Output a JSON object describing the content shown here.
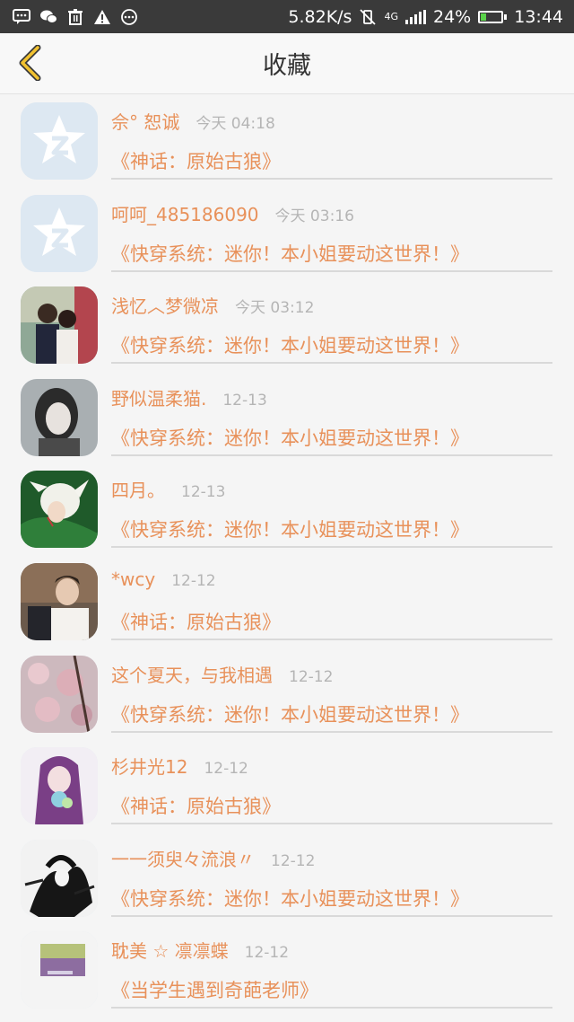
{
  "status_bar": {
    "net_speed": "5.82K/s",
    "network": "4G",
    "battery": "24%",
    "battery_level": 0.24,
    "time": "13:44"
  },
  "header": {
    "title": "收藏",
    "back_icon": "chevron-left-icon"
  },
  "items": [
    {
      "user": "佘° 恕诚",
      "time": "今天 04:18",
      "book": "《神话：原始古狼》",
      "avatar": "qq-default"
    },
    {
      "user": "呵呵_485186090",
      "time": "今天 03:16",
      "book": "《快穿系统：迷你！本小姐要动这世界！》",
      "avatar": "qq-default"
    },
    {
      "user": "浅忆︿梦微凉",
      "time": "今天 03:12",
      "book": "《快穿系统：迷你！本小姐要动这世界！》",
      "avatar": "couple-photo"
    },
    {
      "user": "野似温柔猫.",
      "time": "12-13",
      "book": "《快穿系统：迷你！本小姐要动这世界！》",
      "avatar": "girl-photo"
    },
    {
      "user": "四月。",
      "time": "12-13",
      "book": "《快穿系统：迷你！本小姐要动这世界！》",
      "avatar": "anime-green"
    },
    {
      "user": "*wcy",
      "time": "12-12",
      "book": "《神话：原始古狼》",
      "avatar": "boy-photo"
    },
    {
      "user": "这个夏天，与我相遇",
      "time": "12-12",
      "book": "《快穿系统：迷你！本小姐要动这世界！》",
      "avatar": "blossom-photo"
    },
    {
      "user": "杉井光12",
      "time": "12-12",
      "book": "《神话：原始古狼》",
      "avatar": "anime-purple"
    },
    {
      "user": "一一须臾々流浪〃",
      "time": "12-12",
      "book": "《快穿系统：迷你！本小姐要动这世界！》",
      "avatar": "ink-drawing"
    },
    {
      "user": "耽美 ☆ 凛凛蝶",
      "time": "12-12",
      "book": "《当学生遇到奇葩老师》",
      "avatar": "small-photo"
    }
  ],
  "colors": {
    "accent": "#e8915a",
    "time": "#b5b5b5",
    "statusbar": "#3a3a3a",
    "title": "#333333"
  }
}
